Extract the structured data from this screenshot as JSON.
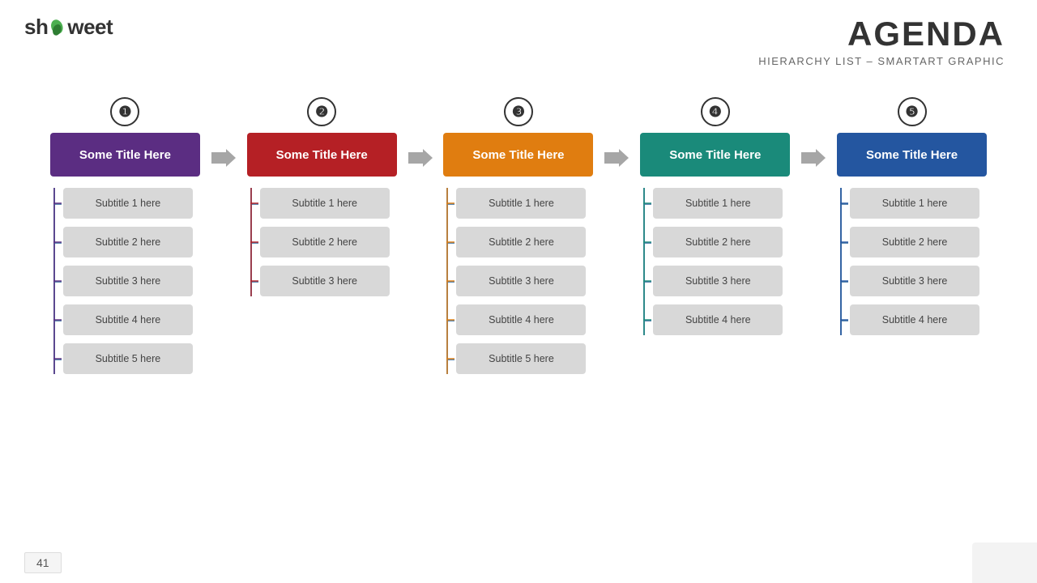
{
  "logo": {
    "text_before": "sh",
    "text_after": "weet",
    "leaf_symbol": "🌿"
  },
  "header": {
    "main_title": "Agenda",
    "sub_title": "Hierarchy List – SmartArt Graphic"
  },
  "columns": [
    {
      "number": "❶",
      "title": "Some Title Here",
      "color": "#5b2d82",
      "subtitles": [
        "Subtitle 1 here",
        "Subtitle 2 here",
        "Subtitle 3 here",
        "Subtitle 4 here",
        "Subtitle 5 here"
      ]
    },
    {
      "number": "❷",
      "title": "Some Title Here",
      "color": "#b52025",
      "subtitles": [
        "Subtitle 1 here",
        "Subtitle 2 here",
        "Subtitle 3 here"
      ]
    },
    {
      "number": "❸",
      "title": "Some Title Here",
      "color": "#e07d10",
      "subtitles": [
        "Subtitle 1 here",
        "Subtitle 2 here",
        "Subtitle 3 here",
        "Subtitle 4 here",
        "Subtitle 5 here"
      ]
    },
    {
      "number": "❹",
      "title": "Some Title Here",
      "color": "#1a8a7a",
      "subtitles": [
        "Subtitle 1 here",
        "Subtitle 2 here",
        "Subtitle 3 here",
        "Subtitle 4 here"
      ]
    },
    {
      "number": "❺",
      "title": "Some Title Here",
      "color": "#2456a0",
      "subtitles": [
        "Subtitle 1 here",
        "Subtitle 2 here",
        "Subtitle 3 here",
        "Subtitle 4 here"
      ]
    }
  ],
  "page_number": "41"
}
